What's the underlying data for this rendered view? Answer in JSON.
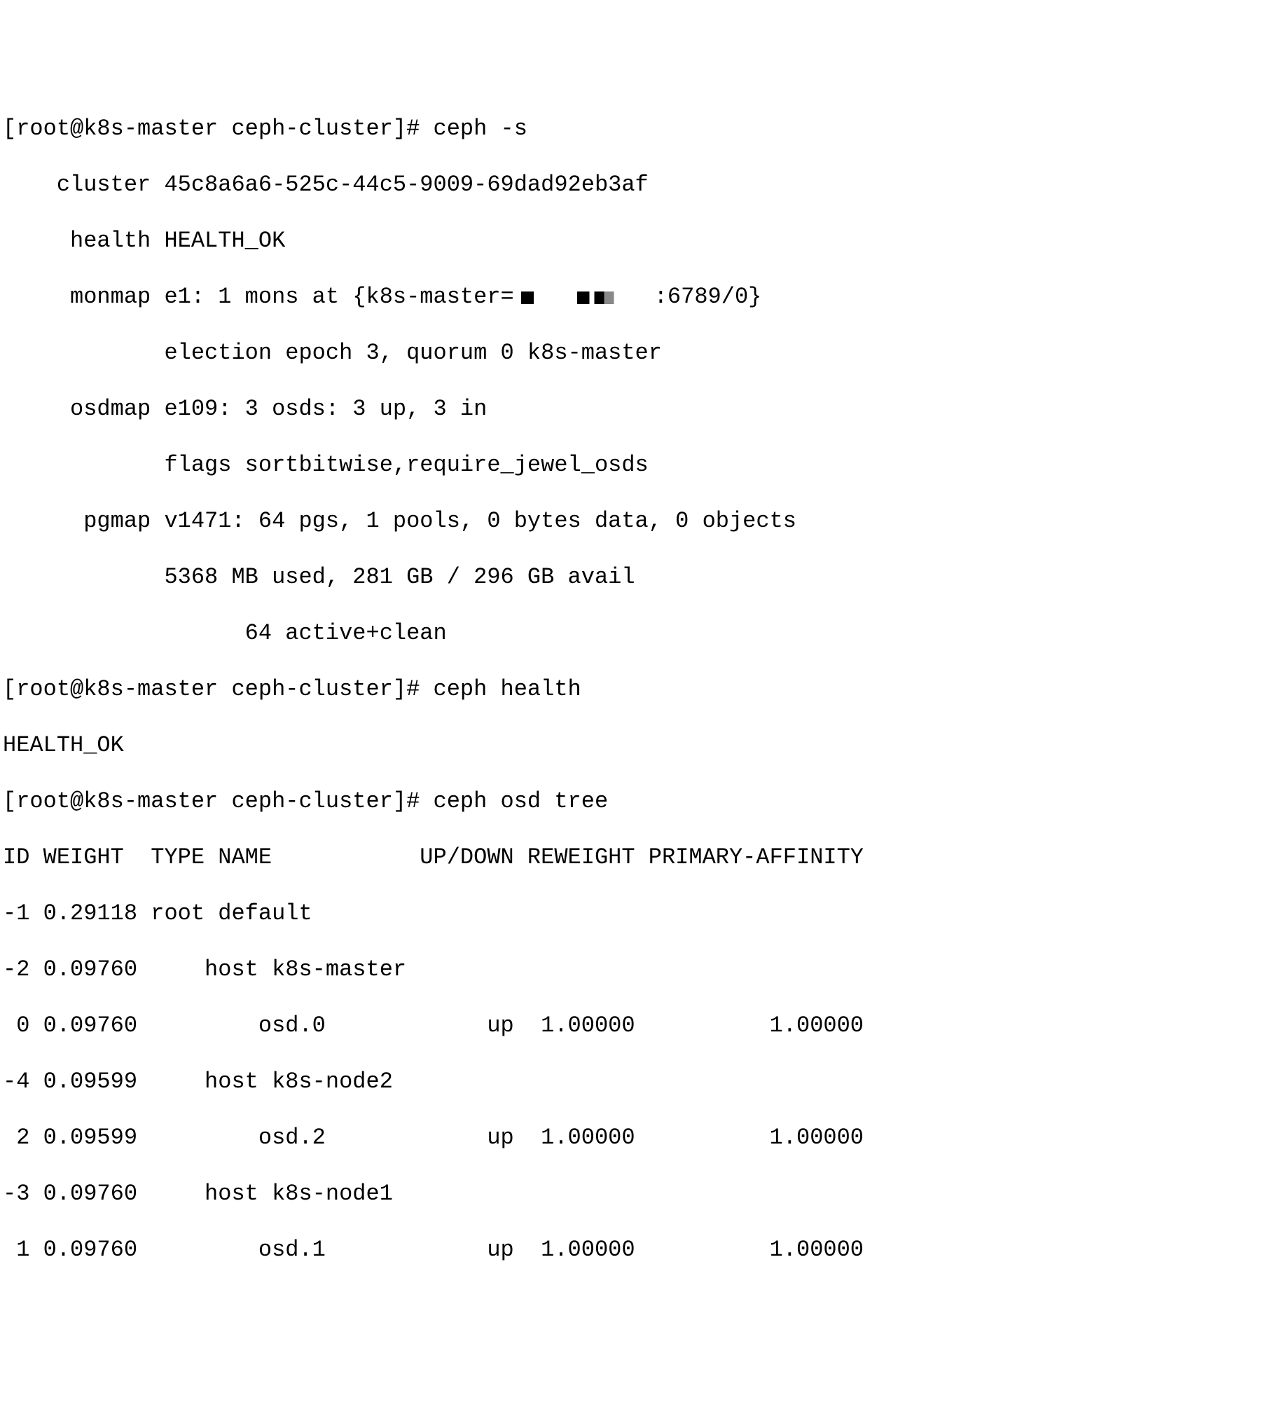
{
  "prompt1": "[root@k8s-master ceph-cluster]# ",
  "cmd1": "ceph -s",
  "status": {
    "cluster_label": "    cluster ",
    "cluster_id": "45c8a6a6-525c-44c5-9009-69dad92eb3af",
    "health_label": "     health ",
    "health_value": "HEALTH_OK",
    "monmap_label": "     monmap ",
    "monmap_prefix": "e1: 1 mons at {k8s-master=",
    "monmap_suffix": ":6789/0}",
    "election": "            election epoch 3, quorum 0 k8s-master",
    "osdmap_label": "     osdmap ",
    "osdmap_value": "e109: 3 osds: 3 up, 3 in",
    "flags": "            flags sortbitwise,require_jewel_osds",
    "pgmap_label": "      pgmap ",
    "pgmap_value": "v1471: 64 pgs, 1 pools, 0 bytes data, 0 objects",
    "usage": "            5368 MB used, 281 GB / 296 GB avail",
    "pgstate": "                  64 active+clean"
  },
  "prompt2": "[root@k8s-master ceph-cluster]# ",
  "cmd2": "ceph health",
  "health_output": "HEALTH_OK",
  "prompt3": "[root@k8s-master ceph-cluster]# ",
  "cmd3": "ceph osd tree",
  "tree": {
    "header": "ID WEIGHT  TYPE NAME           UP/DOWN REWEIGHT PRIMARY-AFFINITY",
    "rows": [
      "-1 0.29118 root default",
      "-2 0.09760     host k8s-master",
      " 0 0.09760         osd.0            up  1.00000          1.00000",
      "-4 0.09599     host k8s-node2",
      " 2 0.09599         osd.2            up  1.00000          1.00000",
      "-3 0.09760     host k8s-node1",
      " 1 0.09760         osd.1            up  1.00000          1.00000"
    ]
  }
}
